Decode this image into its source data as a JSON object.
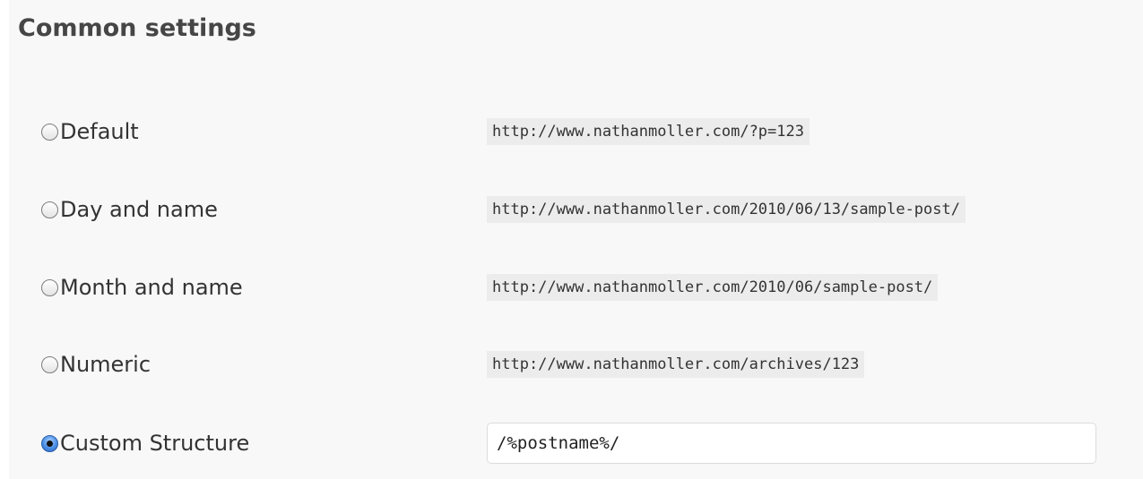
{
  "section": {
    "title": "Common settings"
  },
  "permalink_options": [
    {
      "label": "Default",
      "sample": "http://www.nathanmoller.com/?p=123",
      "checked": false
    },
    {
      "label": "Day and name",
      "sample": "http://www.nathanmoller.com/2010/06/13/sample-post/",
      "checked": false
    },
    {
      "label": "Month and name",
      "sample": "http://www.nathanmoller.com/2010/06/sample-post/",
      "checked": false
    },
    {
      "label": "Numeric",
      "sample": "http://www.nathanmoller.com/archives/123",
      "checked": false
    }
  ],
  "custom_structure": {
    "label": "Custom Structure",
    "value": "/%postname%/",
    "checked": true
  },
  "colors": {
    "panel_background": "#f8f8f8",
    "heading_text": "#464646",
    "sample_background": "#ececec",
    "radio_selected": "#4b8ee6"
  }
}
